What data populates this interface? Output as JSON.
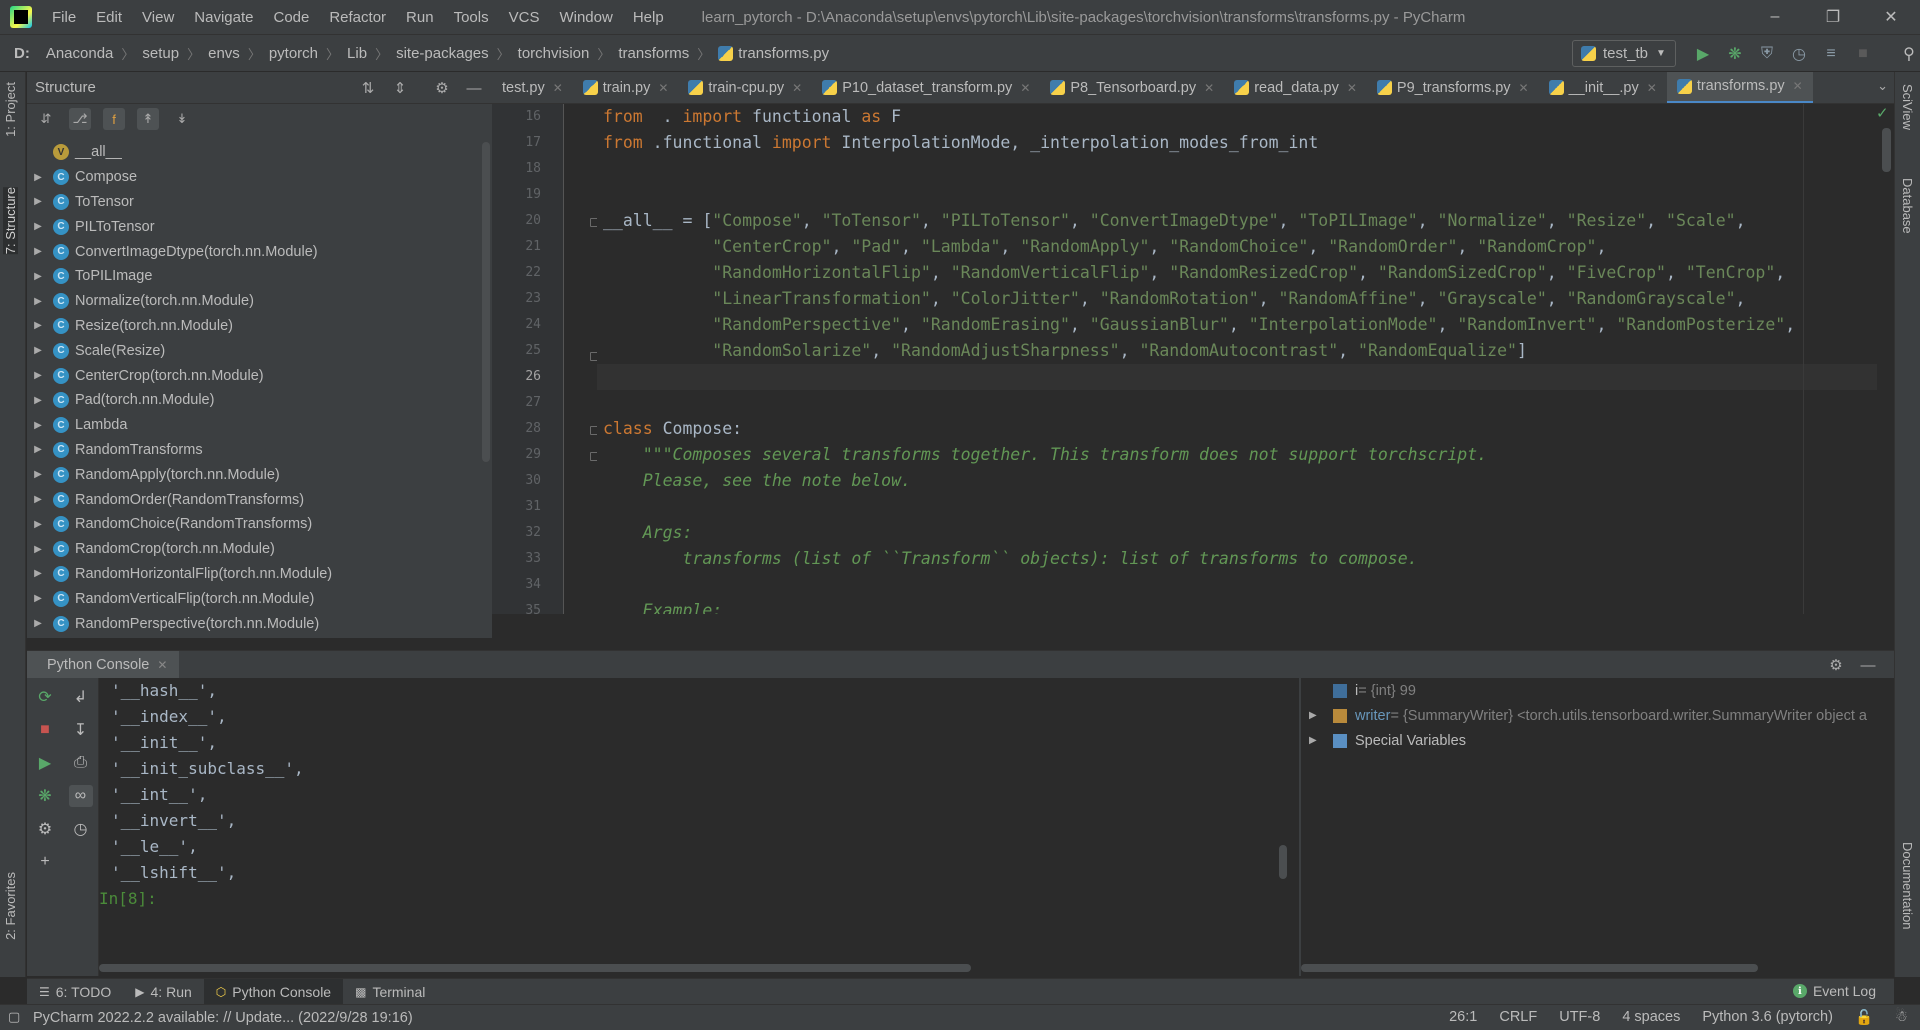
{
  "app": {
    "menu": [
      "File",
      "Edit",
      "View",
      "Navigate",
      "Code",
      "Refactor",
      "Run",
      "Tools",
      "VCS",
      "Window",
      "Help"
    ],
    "window_title": "learn_pytorch - D:\\Anaconda\\setup\\envs\\pytorch\\Lib\\site-packages\\torchvision\\transforms\\transforms.py - PyCharm"
  },
  "nav": {
    "breadcrumbs": [
      "D:",
      "Anaconda",
      "setup",
      "envs",
      "pytorch",
      "Lib",
      "site-packages",
      "torchvision",
      "transforms",
      "transforms.py"
    ],
    "run_config": "test_tb"
  },
  "left_strip": {
    "project_tab": "1: Project",
    "structure_tab": "7: Structure",
    "favorites_tab": "2: Favorites"
  },
  "right_strip": {
    "sciview_tab": "SciView",
    "database_tab": "Database",
    "documentation_tab": "Documentation"
  },
  "structure": {
    "title": "Structure",
    "items": [
      {
        "label": "__all__",
        "kind": "variable",
        "expandable": false
      },
      {
        "label": "Compose",
        "kind": "class",
        "expandable": true
      },
      {
        "label": "ToTensor",
        "kind": "class",
        "expandable": true
      },
      {
        "label": "PILToTensor",
        "kind": "class",
        "expandable": true
      },
      {
        "label": "ConvertImageDtype(torch.nn.Module)",
        "kind": "class",
        "expandable": true
      },
      {
        "label": "ToPILImage",
        "kind": "class",
        "expandable": true
      },
      {
        "label": "Normalize(torch.nn.Module)",
        "kind": "class",
        "expandable": true
      },
      {
        "label": "Resize(torch.nn.Module)",
        "kind": "class",
        "expandable": true
      },
      {
        "label": "Scale(Resize)",
        "kind": "class",
        "expandable": true
      },
      {
        "label": "CenterCrop(torch.nn.Module)",
        "kind": "class",
        "expandable": true
      },
      {
        "label": "Pad(torch.nn.Module)",
        "kind": "class",
        "expandable": true
      },
      {
        "label": "Lambda",
        "kind": "class",
        "expandable": true
      },
      {
        "label": "RandomTransforms",
        "kind": "class",
        "expandable": true
      },
      {
        "label": "RandomApply(torch.nn.Module)",
        "kind": "class",
        "expandable": true
      },
      {
        "label": "RandomOrder(RandomTransforms)",
        "kind": "class",
        "expandable": true
      },
      {
        "label": "RandomChoice(RandomTransforms)",
        "kind": "class",
        "expandable": true
      },
      {
        "label": "RandomCrop(torch.nn.Module)",
        "kind": "class",
        "expandable": true
      },
      {
        "label": "RandomHorizontalFlip(torch.nn.Module)",
        "kind": "class",
        "expandable": true
      },
      {
        "label": "RandomVerticalFlip(torch.nn.Module)",
        "kind": "class",
        "expandable": true
      },
      {
        "label": "RandomPerspective(torch.nn.Module)",
        "kind": "class",
        "expandable": true
      }
    ]
  },
  "editor": {
    "tabs": [
      {
        "label": "test.py",
        "active": false
      },
      {
        "label": "train.py",
        "active": false
      },
      {
        "label": "train-cpu.py",
        "active": false
      },
      {
        "label": "P10_dataset_transform.py",
        "active": false
      },
      {
        "label": "P8_Tensorboard.py",
        "active": false
      },
      {
        "label": "read_data.py",
        "active": false
      },
      {
        "label": "P9_transforms.py",
        "active": false
      },
      {
        "label": "__init__.py",
        "active": false
      },
      {
        "label": "transforms.py",
        "active": true
      }
    ],
    "current_line": 26,
    "lines": [
      {
        "n": 16,
        "tokens": [
          [
            "kw",
            "from"
          ],
          [
            "",
            "  . "
          ],
          [
            "kw",
            "import"
          ],
          [
            "",
            " functional "
          ],
          [
            "kw",
            "as"
          ],
          [
            "",
            " F"
          ]
        ]
      },
      {
        "n": 17,
        "tokens": [
          [
            "kw",
            "from"
          ],
          [
            "",
            " .functional "
          ],
          [
            "kw",
            "import"
          ],
          [
            "",
            " InterpolationMode, _interpolation_modes_from_int"
          ]
        ]
      },
      {
        "n": 18,
        "tokens": []
      },
      {
        "n": 19,
        "tokens": []
      },
      {
        "n": 20,
        "tokens": [
          [
            "",
            "__all__ = ["
          ],
          [
            "str",
            "\"Compose\""
          ],
          [
            "",
            ", "
          ],
          [
            "str",
            "\"ToTensor\""
          ],
          [
            "",
            ", "
          ],
          [
            "str",
            "\"PILToTensor\""
          ],
          [
            "",
            ", "
          ],
          [
            "str",
            "\"ConvertImageDtype\""
          ],
          [
            "",
            ", "
          ],
          [
            "str",
            "\"ToPILImage\""
          ],
          [
            "",
            ", "
          ],
          [
            "str",
            "\"Normalize\""
          ],
          [
            "",
            ", "
          ],
          [
            "str",
            "\"Resize\""
          ],
          [
            "",
            ", "
          ],
          [
            "str",
            "\"Scale\""
          ],
          [
            "",
            ","
          ]
        ]
      },
      {
        "n": 21,
        "tokens": [
          [
            "",
            "           "
          ],
          [
            "str",
            "\"CenterCrop\""
          ],
          [
            "",
            ", "
          ],
          [
            "str",
            "\"Pad\""
          ],
          [
            "",
            ", "
          ],
          [
            "str",
            "\"Lambda\""
          ],
          [
            "",
            ", "
          ],
          [
            "str",
            "\"RandomApply\""
          ],
          [
            "",
            ", "
          ],
          [
            "str",
            "\"RandomChoice\""
          ],
          [
            "",
            ", "
          ],
          [
            "str",
            "\"RandomOrder\""
          ],
          [
            "",
            ", "
          ],
          [
            "str",
            "\"RandomCrop\""
          ],
          [
            "",
            ","
          ]
        ]
      },
      {
        "n": 22,
        "tokens": [
          [
            "",
            "           "
          ],
          [
            "str",
            "\"RandomHorizontalFlip\""
          ],
          [
            "",
            ", "
          ],
          [
            "str",
            "\"RandomVerticalFlip\""
          ],
          [
            "",
            ", "
          ],
          [
            "str",
            "\"RandomResizedCrop\""
          ],
          [
            "",
            ", "
          ],
          [
            "str",
            "\"RandomSizedCrop\""
          ],
          [
            "",
            ", "
          ],
          [
            "str",
            "\"FiveCrop\""
          ],
          [
            "",
            ", "
          ],
          [
            "str",
            "\"TenCrop\""
          ],
          [
            "",
            ","
          ]
        ]
      },
      {
        "n": 23,
        "tokens": [
          [
            "",
            "           "
          ],
          [
            "str",
            "\"LinearTransformation\""
          ],
          [
            "",
            ", "
          ],
          [
            "str",
            "\"ColorJitter\""
          ],
          [
            "",
            ", "
          ],
          [
            "str",
            "\"RandomRotation\""
          ],
          [
            "",
            ", "
          ],
          [
            "str",
            "\"RandomAffine\""
          ],
          [
            "",
            ", "
          ],
          [
            "str",
            "\"Grayscale\""
          ],
          [
            "",
            ", "
          ],
          [
            "str",
            "\"RandomGrayscale\""
          ],
          [
            "",
            ","
          ]
        ]
      },
      {
        "n": 24,
        "tokens": [
          [
            "",
            "           "
          ],
          [
            "str",
            "\"RandomPerspective\""
          ],
          [
            "",
            ", "
          ],
          [
            "str",
            "\"RandomErasing\""
          ],
          [
            "",
            ", "
          ],
          [
            "str",
            "\"GaussianBlur\""
          ],
          [
            "",
            ", "
          ],
          [
            "str",
            "\"InterpolationMode\""
          ],
          [
            "",
            ", "
          ],
          [
            "str",
            "\"RandomInvert\""
          ],
          [
            "",
            ", "
          ],
          [
            "str",
            "\"RandomPosterize\""
          ],
          [
            "",
            ","
          ]
        ]
      },
      {
        "n": 25,
        "tokens": [
          [
            "",
            "           "
          ],
          [
            "str",
            "\"RandomSolarize\""
          ],
          [
            "",
            ", "
          ],
          [
            "str",
            "\"RandomAdjustSharpness\""
          ],
          [
            "",
            ", "
          ],
          [
            "str",
            "\"RandomAutocontrast\""
          ],
          [
            "",
            ", "
          ],
          [
            "str",
            "\"RandomEqualize\""
          ],
          [
            "",
            "]"
          ]
        ]
      },
      {
        "n": 26,
        "tokens": []
      },
      {
        "n": 27,
        "tokens": []
      },
      {
        "n": 28,
        "tokens": [
          [
            "kw",
            "class"
          ],
          [
            "",
            " Compose:"
          ]
        ]
      },
      {
        "n": 29,
        "tokens": [
          [
            "doc",
            "    \"\"\"Composes several transforms together. This transform does not support torchscript."
          ]
        ]
      },
      {
        "n": 30,
        "tokens": [
          [
            "doc",
            "    Please, see the note below."
          ]
        ]
      },
      {
        "n": 31,
        "tokens": []
      },
      {
        "n": 32,
        "tokens": [
          [
            "doc",
            "    Args:"
          ]
        ]
      },
      {
        "n": 33,
        "tokens": [
          [
            "doc",
            "        transforms (list of ``Transform`` objects): list of transforms to compose."
          ]
        ]
      },
      {
        "n": 34,
        "tokens": []
      },
      {
        "n": 35,
        "tokens": [
          [
            "doc",
            "    Example:"
          ]
        ]
      }
    ]
  },
  "console": {
    "tab_label": "Python Console",
    "output": [
      "'__hash__',",
      "'__index__',",
      "'__init__',",
      "'__init_subclass__',",
      "'__int__',",
      "'__invert__',",
      "'__le__',",
      "'__lshift__',"
    ],
    "prompt": "In[8]:",
    "variables": [
      {
        "name": "i",
        "value": " = {int} 99",
        "expandable": false,
        "icon": "int-icon"
      },
      {
        "name": "writer",
        "value": " = {SummaryWriter} <torch.utils.tensorboard.writer.SummaryWriter object a",
        "expandable": true,
        "icon": "object-icon"
      },
      {
        "name": "Special Variables",
        "value": "",
        "expandable": true,
        "icon": "special-variables-icon"
      }
    ]
  },
  "bottom_tabs": {
    "todo": "6: TODO",
    "run": "4: Run",
    "python_console": "Python Console",
    "terminal": "Terminal",
    "event_log": "Event Log"
  },
  "status": {
    "message": "PyCharm 2022.2.2 available: // Update... (2022/9/28 19:16)",
    "position": "26:1",
    "line_sep": "CRLF",
    "encoding": "UTF-8",
    "indent": "4 spaces",
    "interpreter": "Python 3.6 (pytorch)"
  },
  "colors": {
    "background": "#2b2b2b",
    "panel": "#3c3f41",
    "keyword": "#cc7832",
    "string": "#6a8759",
    "docstring": "#629755",
    "accent": "#4a88c7"
  }
}
